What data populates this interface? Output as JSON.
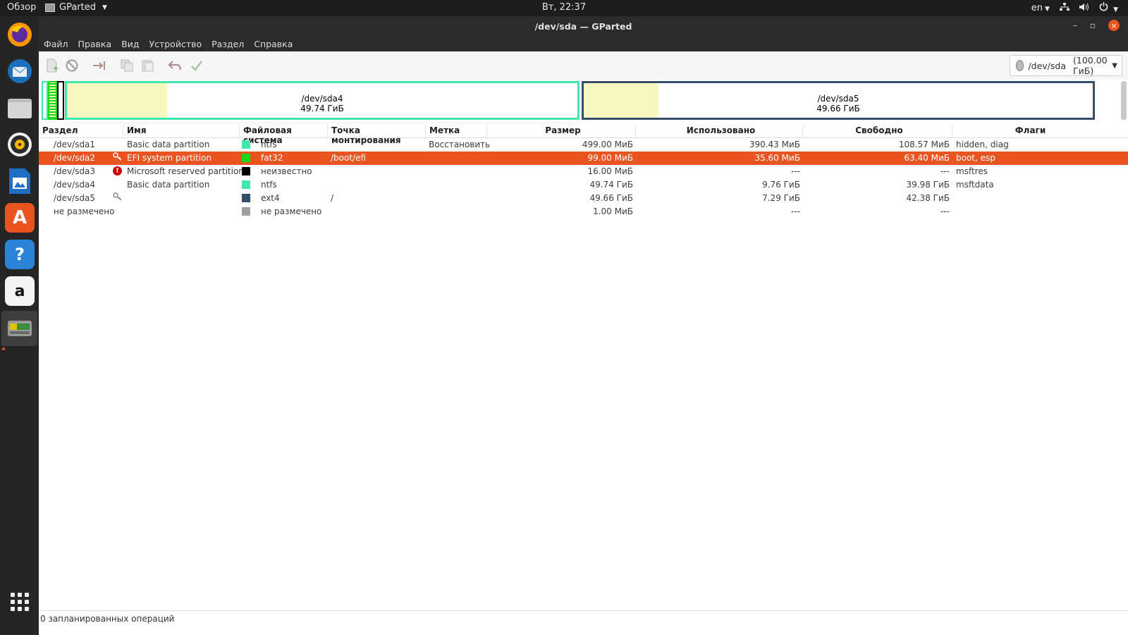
{
  "topbar": {
    "overview": "Обзор",
    "app_name": "GParted",
    "clock": "Вт, 22:37",
    "lang": "en"
  },
  "dock": {
    "items": [
      "firefox-icon",
      "thunderbird-icon",
      "files-icon",
      "rhythmbox-icon",
      "writer-icon",
      "software-icon",
      "help-icon",
      "amazon-icon",
      "gparted-icon"
    ]
  },
  "window": {
    "title": "/dev/sda — GParted",
    "controls": {
      "minimize": "–",
      "maximize": "▫",
      "close": "×"
    }
  },
  "menu": [
    "Файл",
    "Правка",
    "Вид",
    "Устройство",
    "Раздел",
    "Справка"
  ],
  "toolbar": {
    "device_select": {
      "device": "/dev/sda",
      "size": "(100.00 ГиБ)"
    }
  },
  "diskmap": {
    "sda4": {
      "name": "/dev/sda4",
      "size": "49.74 ГиБ",
      "used_fraction": 0.196,
      "color": "#42e5ac"
    },
    "sda5": {
      "name": "/dev/sda5",
      "size": "49.66 ГиБ",
      "used_fraction": 0.147,
      "color": "#344e6c"
    }
  },
  "table": {
    "headers": [
      "Раздел",
      "Имя",
      "Файловая система",
      "Точка монтирования",
      "Метка",
      "Размер",
      "Использовано",
      "Свободно",
      "Флаги"
    ],
    "rows": [
      {
        "partition": "/dev/sda1",
        "name": "Basic data partition",
        "fs": "ntfs",
        "fs_color": "#42e5ac",
        "mount": "",
        "label": "Восстановить",
        "size": "499.00 МиБ",
        "used": "390.43 МиБ",
        "free": "108.57 МиБ",
        "flags": "hidden, diag",
        "icon": ""
      },
      {
        "partition": "/dev/sda2",
        "name": "EFI system partition",
        "fs": "fat32",
        "fs_color": "#18d918",
        "mount": "/boot/efi",
        "label": "",
        "size": "99.00 МиБ",
        "used": "35.60 МиБ",
        "free": "63.40 МиБ",
        "flags": "boot, esp",
        "icon": "key",
        "selected": true
      },
      {
        "partition": "/dev/sda3",
        "name": "Microsoft reserved partition",
        "fs": "неизвестно",
        "fs_color": "#000000",
        "mount": "",
        "label": "",
        "size": "16.00 МиБ",
        "used": "---",
        "free": "---",
        "flags": "msftres",
        "icon": "warning"
      },
      {
        "partition": "/dev/sda4",
        "name": "Basic data partition",
        "fs": "ntfs",
        "fs_color": "#42e5ac",
        "mount": "",
        "label": "",
        "size": "49.74 ГиБ",
        "used": "9.76 ГиБ",
        "free": "39.98 ГиБ",
        "flags": "msftdata",
        "icon": ""
      },
      {
        "partition": "/dev/sda5",
        "name": "",
        "fs": "ext4",
        "fs_color": "#344e6c",
        "mount": "/",
        "label": "",
        "size": "49.66 ГиБ",
        "used": "7.29 ГиБ",
        "free": "42.38 ГиБ",
        "flags": "",
        "icon": "key"
      },
      {
        "partition": "не размечено",
        "name": "",
        "fs": "не размечено",
        "fs_color": "#a0a0a0",
        "mount": "",
        "label": "",
        "size": "1.00 МиБ",
        "used": "---",
        "free": "---",
        "flags": "",
        "icon": ""
      }
    ]
  },
  "statusbar": {
    "text": "0 запланированных операций"
  },
  "colors": {
    "accent": "#e95420",
    "topbar": "#1d1d1d",
    "titlebar": "#2b2b2b"
  }
}
